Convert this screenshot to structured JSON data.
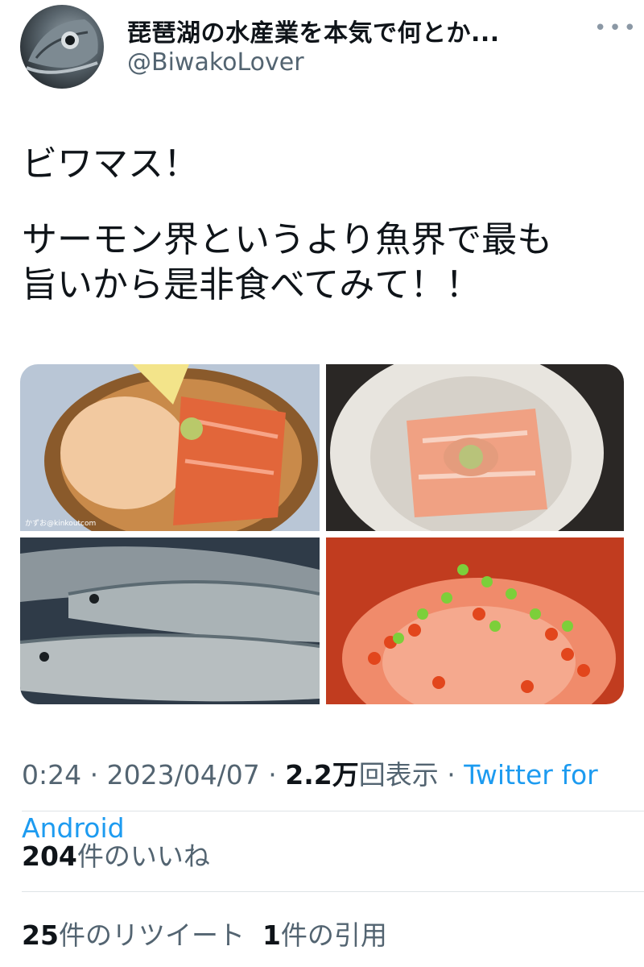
{
  "header": {
    "display_name": "琵琶湖の水産業を本気で何とか...",
    "handle": "@BiwakoLover",
    "more_icon": "more-dots-icon",
    "avatar_icon": "fish-avatar"
  },
  "tweet": {
    "line1": "ビワマス！",
    "line2": "サーモン界というより魚界で最も",
    "line3": "旨いから是非食べてみて！！"
  },
  "media": {
    "photo1_caption": "かずお@kinkoutcom"
  },
  "meta": {
    "time": "0:24",
    "sep1": " · ",
    "date": "2023/04/07",
    "sep2": " · ",
    "views_count": "2.2万",
    "views_label": "回表示",
    "sep3": " · ",
    "source": "Twitter for Android"
  },
  "stats": {
    "likes_count": "204",
    "likes_label": "件のいいね",
    "retweets_count": "25",
    "retweets_label": "件のリツイート",
    "quotes_count": "1",
    "quotes_label": "件の引用"
  },
  "colors": {
    "accent": "#1d9bf0",
    "secondary_text": "#536471",
    "primary_text": "#0f1419"
  }
}
